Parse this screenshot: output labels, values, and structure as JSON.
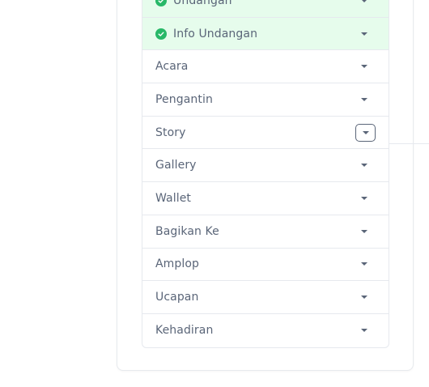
{
  "accordion": {
    "items": [
      {
        "label": "Undangan",
        "state": "completed"
      },
      {
        "label": "Info Undangan",
        "state": "completed"
      },
      {
        "label": "Acara",
        "state": "default"
      },
      {
        "label": "Pengantin",
        "state": "default"
      },
      {
        "label": "Story",
        "state": "focused"
      },
      {
        "label": "Gallery",
        "state": "default"
      },
      {
        "label": "Wallet",
        "state": "default"
      },
      {
        "label": "Bagikan Ke",
        "state": "default"
      },
      {
        "label": "Amplop",
        "state": "default"
      },
      {
        "label": "Ucapan",
        "state": "default"
      },
      {
        "label": "Kehadiran",
        "state": "default"
      }
    ]
  },
  "colors": {
    "completed_bg": "#e6fcec",
    "check": "#28b868",
    "text": "#5a6578",
    "border": "#e6e9ee"
  },
  "icons": {
    "completed": "check-circle-icon",
    "toggle": "caret-down-icon"
  }
}
